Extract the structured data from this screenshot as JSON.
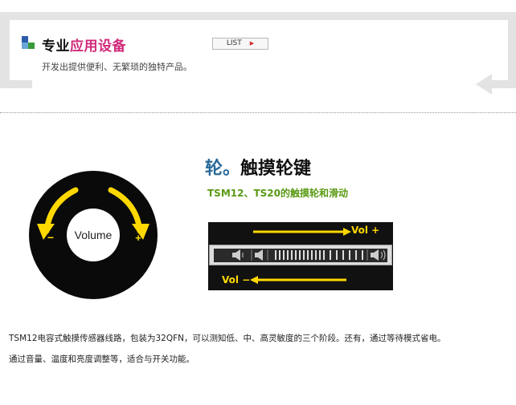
{
  "header": {
    "title_part1": "专业",
    "title_part2": "应用设备",
    "subtitle": "开发出提供便利、无繁琐的独特产品。",
    "list_label": "LIST"
  },
  "wheel": {
    "center_label": "Volume",
    "minus_label": "−",
    "plus_label": "+"
  },
  "feature": {
    "heading_part1": "轮。",
    "heading_part2": "触摸轮键",
    "subheading": "TSM12、TS20的触摸轮和滑动"
  },
  "slider": {
    "vol_plus": "Vol +",
    "vol_minus": "Vol −"
  },
  "description": {
    "line1": "TSM12电容式触摸传感器线路，包装为32QFN，可以测知低、中、高灵敏度的三个阶段。还有，通过等待模式省电。",
    "line2": "通过音量、温度和亮度调整等，适合与开关功能。"
  },
  "colors": {
    "accent_pink": "#d02a7a",
    "heading_blue": "#2a6a9a",
    "subheading_green": "#5a9a14",
    "arrow_yellow": "#ffd800"
  }
}
